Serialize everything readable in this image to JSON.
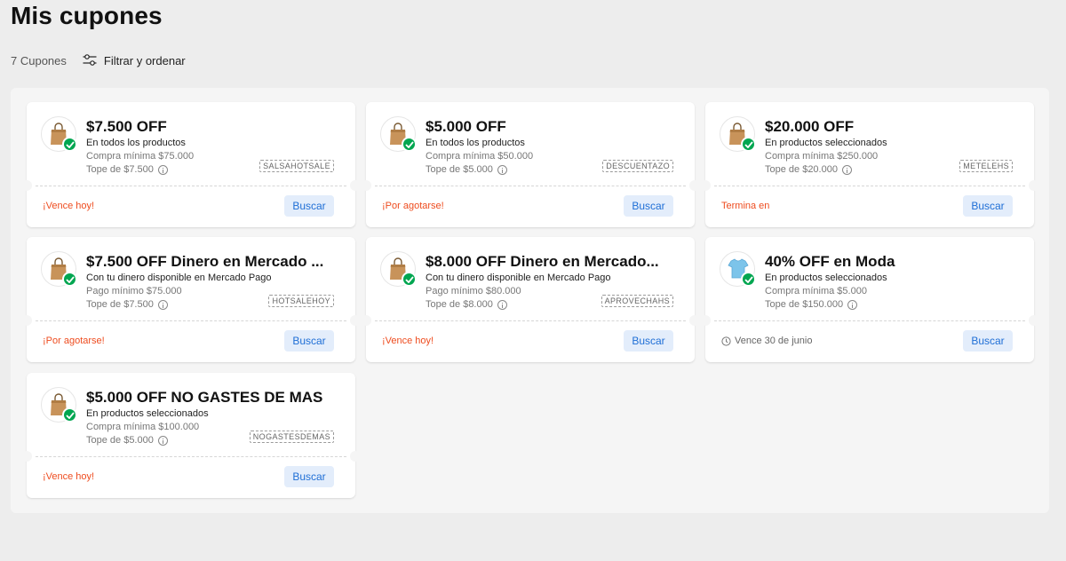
{
  "page": {
    "title": "Mis cupones"
  },
  "toolbar": {
    "count": "7 Cupones",
    "filter_label": "Filtrar y ordenar"
  },
  "coupons": [
    {
      "title": "$7.500 OFF",
      "subtitle": "En todos los productos",
      "line1": "Compra mínima $75.000",
      "line2": "Tope de $7.500",
      "code": "SALSAHOTSALE",
      "status": "¡Vence hoy!",
      "status_kind": "warn",
      "button": "Buscar",
      "product_icon": "paper-bag-icon"
    },
    {
      "title": "$5.000 OFF",
      "subtitle": "En todos los productos",
      "line1": "Compra mínima $50.000",
      "line2": "Tope de $5.000",
      "code": "DESCUENTAZO",
      "status": "¡Por agotarse!",
      "status_kind": "warn",
      "button": "Buscar",
      "product_icon": "paper-bag-icon"
    },
    {
      "title": "$20.000 OFF",
      "subtitle": "En productos seleccionados",
      "line1": "Compra mínima $250.000",
      "line2": "Tope de $20.000",
      "code": "METELEHS",
      "status": "Termina en",
      "status_kind": "warn",
      "button": "Buscar",
      "product_icon": "paper-bag-icon"
    },
    {
      "title": "$7.500 OFF Dinero en Mercado ...",
      "subtitle": "Con tu dinero disponible en Mercado Pago",
      "line1": "Pago mínimo $75.000",
      "line2": "Tope de $7.500",
      "code": "HOTSALEHOY",
      "status": "¡Por agotarse!",
      "status_kind": "warn",
      "button": "Buscar",
      "product_icon": "paper-bag-icon"
    },
    {
      "title": "$8.000 OFF Dinero en Mercado...",
      "subtitle": "Con tu dinero disponible en Mercado Pago",
      "line1": "Pago mínimo $80.000",
      "line2": "Tope de $8.000",
      "code": "APROVECHAHS",
      "status": "¡Vence hoy!",
      "status_kind": "warn",
      "button": "Buscar",
      "product_icon": "paper-bag-icon"
    },
    {
      "title": "40% OFF en Moda",
      "subtitle": "En productos seleccionados",
      "line1": "Compra mínima $5.000",
      "line2": "Tope de $150.000",
      "code": "",
      "status": "Vence 30 de junio",
      "status_kind": "gray",
      "button": "Buscar",
      "product_icon": "t-shirt-icon"
    },
    {
      "title": "$5.000 OFF NO GASTES DE MAS",
      "subtitle": "En productos seleccionados",
      "line1": "Compra mínima $100.000",
      "line2": "Tope de $5.000",
      "code": "NOGASTESDEMAS",
      "status": "¡Vence hoy!",
      "status_kind": "warn",
      "button": "Buscar",
      "product_icon": "paper-bag-icon"
    }
  ],
  "colors": {
    "accent": "#3483fa",
    "success": "#00a650",
    "warning": "#ee4c1f",
    "button_bg": "#e3edfb"
  }
}
